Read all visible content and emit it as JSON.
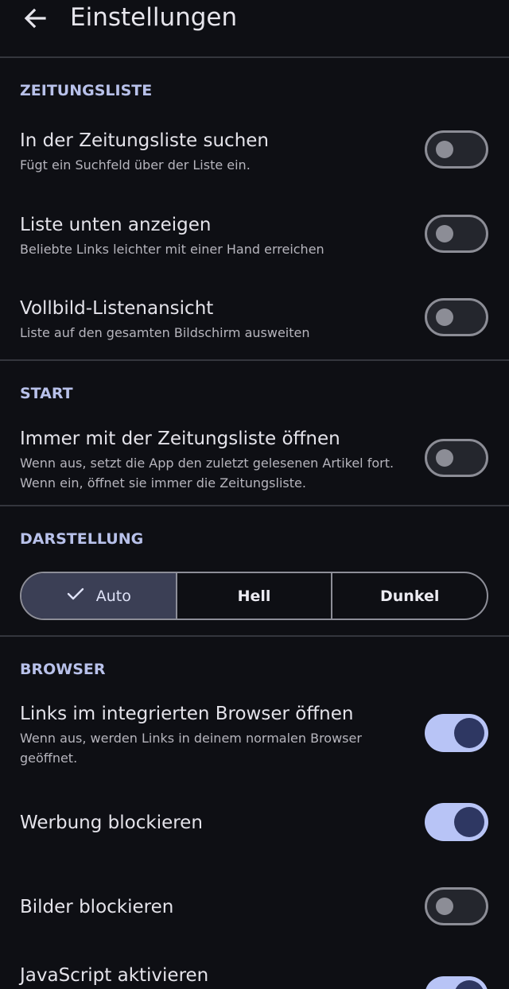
{
  "header": {
    "title": "Einstellungen",
    "back_icon": "arrow-left-icon"
  },
  "colors": {
    "background": "#0e0f14",
    "accent": "#b8c4f6",
    "section_title": "#b8c1ea"
  },
  "sections": {
    "zeitungsliste": {
      "title": "ZEITUNGSLISTE",
      "items": [
        {
          "title": "In der Zeitungsliste suchen",
          "description": "Fügt ein Suchfeld über der Liste ein.",
          "enabled": false
        },
        {
          "title": "Liste unten anzeigen",
          "description": "Beliebte Links leichter mit einer Hand erreichen",
          "enabled": false
        },
        {
          "title": "Vollbild-Listenansicht",
          "description": "Liste auf den gesamten Bildschirm ausweiten",
          "enabled": false
        }
      ]
    },
    "start": {
      "title": "START",
      "items": [
        {
          "title": "Immer mit der Zeitungsliste öffnen",
          "description": "Wenn aus, setzt die App den zuletzt gelesenen Artikel fort. Wenn ein, öffnet sie immer die Zeitungsliste.",
          "enabled": false
        }
      ]
    },
    "darstellung": {
      "title": "DARSTELLUNG",
      "options": [
        "Auto",
        "Hell",
        "Dunkel"
      ],
      "selected": "Auto",
      "selected_icon": "check-icon"
    },
    "browser": {
      "title": "BROWSER",
      "items": [
        {
          "title": "Links im integrierten Browser öffnen",
          "description": "Wenn aus, werden Links in deinem normalen Browser geöffnet.",
          "enabled": true
        },
        {
          "title": "Werbung blockieren",
          "enabled": true
        },
        {
          "title": "Bilder blockieren",
          "enabled": false
        },
        {
          "title": "JavaScript aktivieren",
          "enabled": true
        }
      ]
    }
  }
}
